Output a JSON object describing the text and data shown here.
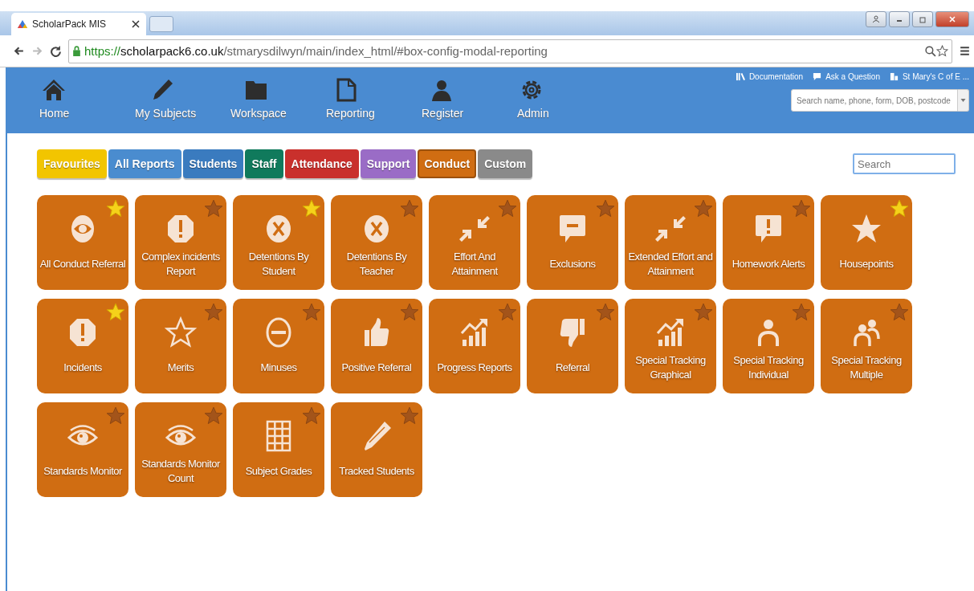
{
  "browser": {
    "tab_title": "ScholarPack MIS",
    "url_scheme": "https://",
    "url_host": "scholarpack6.co.uk",
    "url_path": "/stmarysdilwyn/main/index_html/#box-config-modal-reporting"
  },
  "nav": [
    {
      "label": "Home",
      "kind": "home"
    },
    {
      "label": "My Subjects",
      "kind": "pencil"
    },
    {
      "label": "Workspace",
      "kind": "folder"
    },
    {
      "label": "Reporting",
      "kind": "document"
    },
    {
      "label": "Register",
      "kind": "person"
    },
    {
      "label": "Admin",
      "kind": "gear"
    }
  ],
  "top_links": [
    {
      "label": "Documentation",
      "kind": "books"
    },
    {
      "label": "Ask a Question",
      "kind": "speech"
    },
    {
      "label": "St Mary's C of E ...",
      "kind": "building"
    }
  ],
  "global_search": {
    "placeholder": "Search name, phone, form, DOB, postcode"
  },
  "filters": [
    {
      "label": "Favourites",
      "color": "#f2c500",
      "selected": false
    },
    {
      "label": "All Reports",
      "color": "#4a8ccf",
      "selected": false
    },
    {
      "label": "Students",
      "color": "#3a7bbf",
      "selected": false
    },
    {
      "label": "Staff",
      "color": "#107a5c",
      "selected": false
    },
    {
      "label": "Attendance",
      "color": "#c9302c",
      "selected": false
    },
    {
      "label": "Support",
      "color": "#9a6cc6",
      "selected": false
    },
    {
      "label": "Conduct",
      "color": "#d06d12",
      "selected": true
    },
    {
      "label": "Custom",
      "color": "#8a8a8a",
      "selected": false
    }
  ],
  "report_search": {
    "placeholder": "Search"
  },
  "reports": [
    {
      "label": "All Conduct Referral",
      "kind": "eye-circle",
      "favourite": true
    },
    {
      "label": "Complex incidents Report",
      "kind": "octagon-alert",
      "favourite": false
    },
    {
      "label": "Detentions By Student",
      "kind": "circle-x",
      "favourite": true
    },
    {
      "label": "Detentions By Teacher",
      "kind": "circle-x",
      "favourite": false
    },
    {
      "label": "Effort And Attainment",
      "kind": "arrows-in",
      "favourite": false
    },
    {
      "label": "Exclusions",
      "kind": "speech-minus",
      "favourite": false
    },
    {
      "label": "Extended Effort and Attainment",
      "kind": "arrows-in",
      "favourite": false
    },
    {
      "label": "Homework Alerts",
      "kind": "speech-alert",
      "favourite": false
    },
    {
      "label": "Housepoints",
      "kind": "star",
      "favourite": true
    },
    {
      "label": "Incidents",
      "kind": "octagon-alert",
      "favourite": true
    },
    {
      "label": "Merits",
      "kind": "star-outline",
      "favourite": false
    },
    {
      "label": "Minuses",
      "kind": "circle-minus",
      "favourite": false
    },
    {
      "label": "Positive Referral",
      "kind": "thumbs-up",
      "favourite": false
    },
    {
      "label": "Progress Reports",
      "kind": "chart-up",
      "favourite": false
    },
    {
      "label": "Referral",
      "kind": "thumbs-down",
      "favourite": false
    },
    {
      "label": "Special Tracking Graphical",
      "kind": "chart-up",
      "favourite": false
    },
    {
      "label": "Special Tracking Individual",
      "kind": "person",
      "favourite": false
    },
    {
      "label": "Special Tracking Multiple",
      "kind": "people",
      "favourite": false
    },
    {
      "label": "Standards Monitor",
      "kind": "eye",
      "favourite": false
    },
    {
      "label": "Standards Monitor Count",
      "kind": "eye",
      "favourite": false
    },
    {
      "label": "Subject Grades",
      "kind": "grid",
      "favourite": false
    },
    {
      "label": "Tracked Students",
      "kind": "pencil",
      "favourite": false
    }
  ]
}
